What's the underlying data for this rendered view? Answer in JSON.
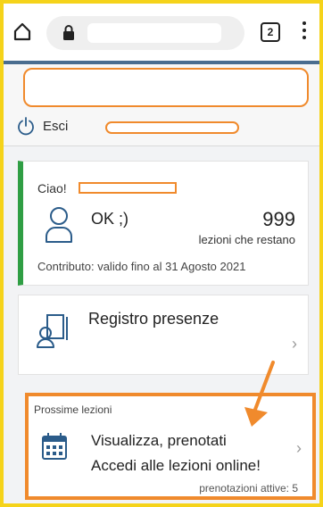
{
  "browser": {
    "tab_count": "2"
  },
  "header": {
    "logout_label": "Esci"
  },
  "user_card": {
    "greeting": "Ciao!",
    "status": "OK ;)",
    "remaining_count": "999",
    "remaining_label": "lezioni che restano",
    "contribution": "Contributo: valido fino al 31 Agosto 2021",
    "accent_color": "#2f9e44"
  },
  "registro": {
    "label": "Registro presenze"
  },
  "lezioni": {
    "section_title": "Prossime lezioni",
    "line1": "Visualizza, prenotati",
    "line2": "Accedi alle lezioni online!",
    "bookings": "prenotazioni attive: 5"
  },
  "colors": {
    "annotation": "#f08a2c",
    "frame": "#f5d31a"
  }
}
